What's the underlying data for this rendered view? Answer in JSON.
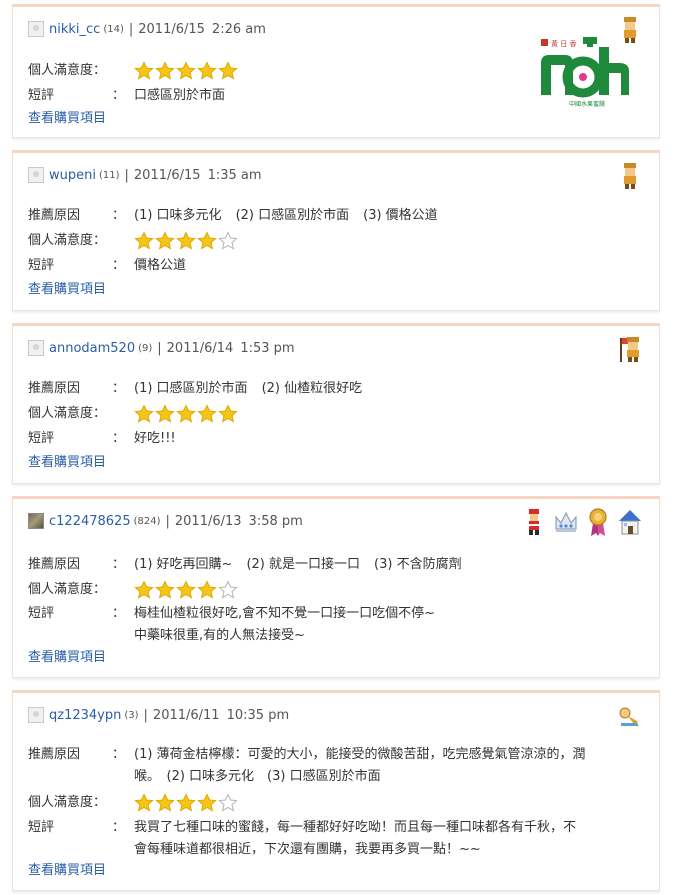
{
  "labels": {
    "reason": "推薦原因",
    "satisfaction": "個人滿意度：",
    "comment": "短評",
    "colon": "：",
    "view_link": "查看購買項目"
  },
  "brand_logo": {
    "tag_text": "黃 日 香",
    "sub_text": "中國水果蜜餞",
    "mark": "nan",
    "color": "#1f8a3c"
  },
  "reviews": [
    {
      "username": "nikki_cc",
      "count": "(14)",
      "date": "2011/6/15",
      "time": "2:26 am",
      "rating": 5,
      "reason": [],
      "comment": [
        "口感區別於市面"
      ],
      "badges": [
        "user-figure-icon"
      ]
    },
    {
      "username": "wupeni",
      "count": "(11)",
      "date": "2011/6/15",
      "time": "1:35 am",
      "rating": 4,
      "reason": [
        "(1) 口味多元化",
        "(2) 口感區別於市面",
        "(3) 價格公道"
      ],
      "comment": [
        "價格公道"
      ],
      "badges": [
        "user-figure-icon"
      ]
    },
    {
      "username": "annodam520",
      "count": "(9)",
      "date": "2011/6/14",
      "time": "1:53 pm",
      "rating": 5,
      "reason": [
        "(1) 口感區別於市面",
        "(2) 仙楂粒很好吃"
      ],
      "comment": [
        "好吃!!!"
      ],
      "badges": [
        "flag-figure-icon"
      ]
    },
    {
      "username": "c122478625",
      "count": "(824)",
      "date": "2011/6/13",
      "time": "3:58 pm",
      "rating": 4,
      "reason": [
        "(1) 好吃再回購~",
        "(2) 就是一口接一口",
        "(3) 不含防腐劑"
      ],
      "comment": [
        "梅桂仙楂粒很好吃,會不知不覺一口接一口吃個不停~",
        "中藥味很重,有的人無法接受~"
      ],
      "badges": [
        "santa-figure-icon",
        "crown-icon",
        "medal-icon",
        "house-icon"
      ]
    },
    {
      "username": "qz1234ypn",
      "count": "(3)",
      "date": "2011/6/11",
      "time": "10:35 pm",
      "rating": 4,
      "reason": [
        "(1) 薄荷金桔檸檬：可愛的大小，能接受的微酸苦甜，吃完感覺氣管涼涼的，潤",
        "喉。　(2) 口味多元化　(3) 口感區別於市面"
      ],
      "comment": [
        "我買了七種口味的蜜餞，每一種都好好吃呦！而且每一種口味都各有千秋，不",
        "會每種味道都很相近，下次還有團購，我要再多買一點！~~"
      ],
      "badges": [
        "crawling-figure-icon"
      ]
    }
  ]
}
